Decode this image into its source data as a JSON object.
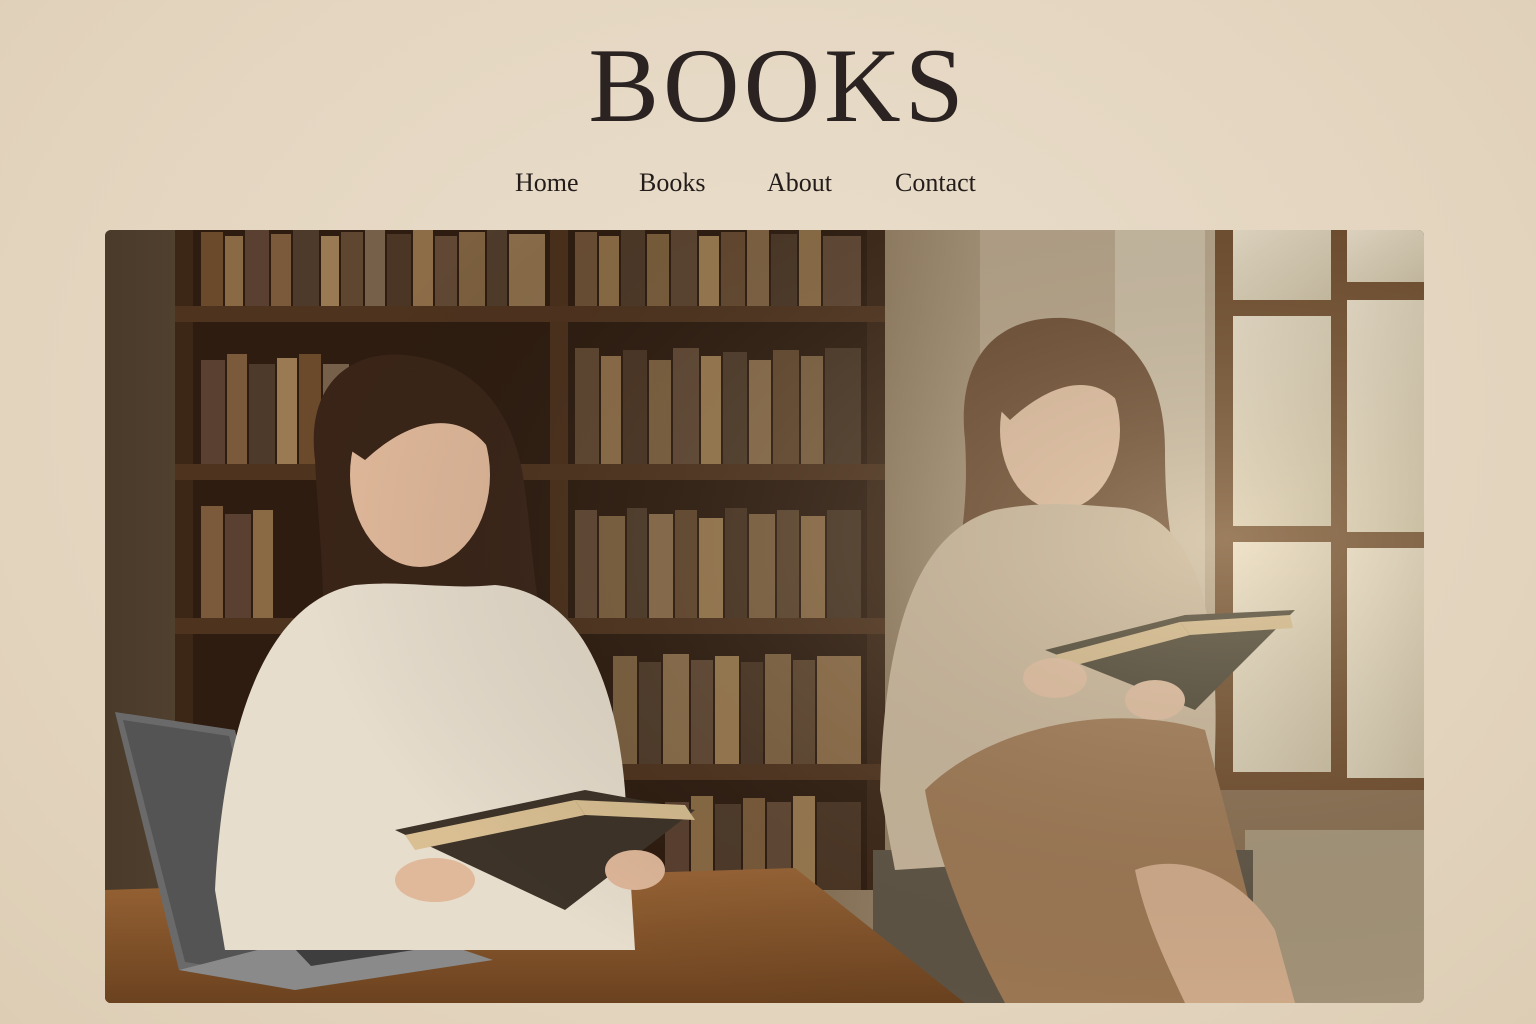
{
  "site": {
    "title": "BOOKS"
  },
  "nav": {
    "items": [
      {
        "label": "Home"
      },
      {
        "label": "Books"
      },
      {
        "label": "About"
      },
      {
        "label": "Contact"
      }
    ]
  },
  "hero": {
    "image_alt": "",
    "colors": {
      "page_background": "#e6d8c4",
      "title": "#2b2321",
      "wood": "#5a3a22",
      "sweater": "#e7ddcd",
      "wall": "#c9b79e"
    }
  }
}
